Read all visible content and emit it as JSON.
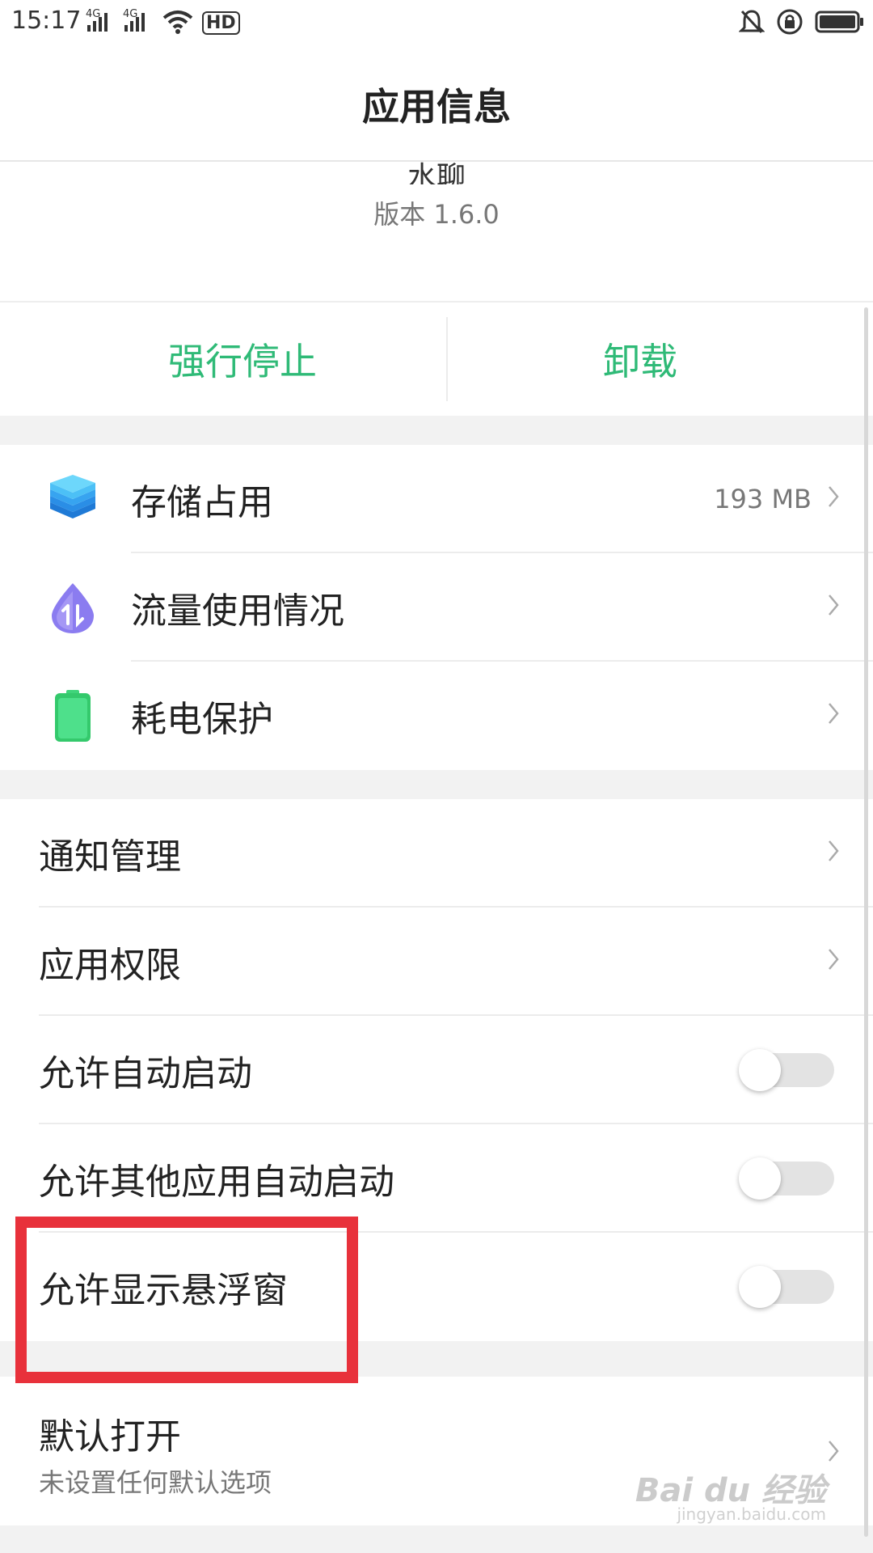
{
  "status_bar": {
    "time": "15:17",
    "network1": "4G",
    "network2": "4G",
    "hd": "HD"
  },
  "title": "应用信息",
  "app": {
    "name": "水聊",
    "version": "版本 1.6.0"
  },
  "actions": {
    "force_stop": "强行停止",
    "uninstall": "卸载"
  },
  "section1": [
    {
      "label": "存储占用",
      "value": "193 MB",
      "icon": "storage-layers-icon"
    },
    {
      "label": "流量使用情况",
      "value": "",
      "icon": "data-usage-drop-icon"
    },
    {
      "label": "耗电保护",
      "value": "",
      "icon": "battery-icon"
    }
  ],
  "section2": {
    "notifications": "通知管理",
    "permissions": "应用权限",
    "auto_start": "允许自动启动",
    "other_auto_start": "允许其他应用自动启动",
    "floating_window": "允许显示悬浮窗"
  },
  "toggles": {
    "auto_start": false,
    "other_auto_start": false,
    "floating_window": false
  },
  "default_open": {
    "title": "默认打开",
    "subtitle": "未设置任何默认选项"
  },
  "watermark": {
    "main": "Bai du 经验",
    "sub": "jingyan.baidu.com"
  },
  "colors": {
    "accent_green": "#2fba77",
    "highlight_red": "#e8313b"
  }
}
